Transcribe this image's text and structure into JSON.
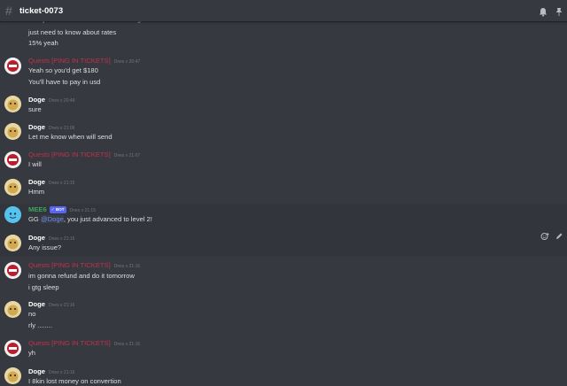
{
  "channel": {
    "name": "ticket-0073",
    "hash_icon": "hash-icon",
    "header_icons": [
      "bell-icon",
      "pin-icon"
    ]
  },
  "top_lines": [
    "its my amount what I want to exchange",
    "just need to know about rates",
    "15% yeah"
  ],
  "messages": [
    {
      "author": "Quests [PING IN TICKETS]",
      "type": "quests",
      "time": "Dnes v 20:47",
      "lines": [
        "Yeah so you'd get $180",
        "You'll have to pay in usd"
      ]
    },
    {
      "author": "Doge",
      "type": "doge",
      "time": "Dnes v 20:48",
      "lines": [
        "sure"
      ]
    },
    {
      "author": "Doge",
      "type": "doge",
      "time": "Dnes v 21:06",
      "lines": [
        "Let me know when will send"
      ]
    },
    {
      "author": "Quests [PING IN TICKETS]",
      "type": "quests",
      "time": "Dnes v 21:07",
      "lines": [
        "I will"
      ]
    },
    {
      "author": "Doge",
      "type": "doge",
      "time": "Dnes v 21:15",
      "lines": [
        "Hmm"
      ]
    },
    {
      "author": "MEE6",
      "type": "mee6",
      "bot_tag": "BOT",
      "time": "Dnes v 21:15",
      "lines_parts": [
        "GG ",
        "@Doge",
        ", you just advanced to level 2!"
      ]
    },
    {
      "author": "Doge",
      "type": "doge",
      "time": "Dnes v 21:16",
      "lines": [
        "Any issue?"
      ]
    },
    {
      "author": "Quests [PING IN TICKETS]",
      "type": "quests",
      "time": "Dnes v 21:16",
      "lines": [
        "im gonna refund and do it tomorrow",
        "i gtg sleep"
      ]
    },
    {
      "author": "Doge",
      "type": "doge",
      "time": "Dnes v 21:16",
      "lines": [
        "no",
        "rly ........"
      ]
    },
    {
      "author": "Quests [PING IN TICKETS]",
      "type": "quests",
      "time": "Dnes v 21:16",
      "lines": [
        "yh"
      ]
    },
    {
      "author": "Doge",
      "type": "doge",
      "time": "Dnes v 21:16",
      "lines": [
        "I 8kin lost money on convertion"
      ]
    }
  ],
  "hover_actions": [
    "add-reaction-icon",
    "edit-icon"
  ],
  "colors": {
    "background": "#36393f",
    "quests": "#c0314a",
    "mee6": "#3ba55c",
    "mention": "#7289da",
    "bot_tag": "#5865f2"
  }
}
